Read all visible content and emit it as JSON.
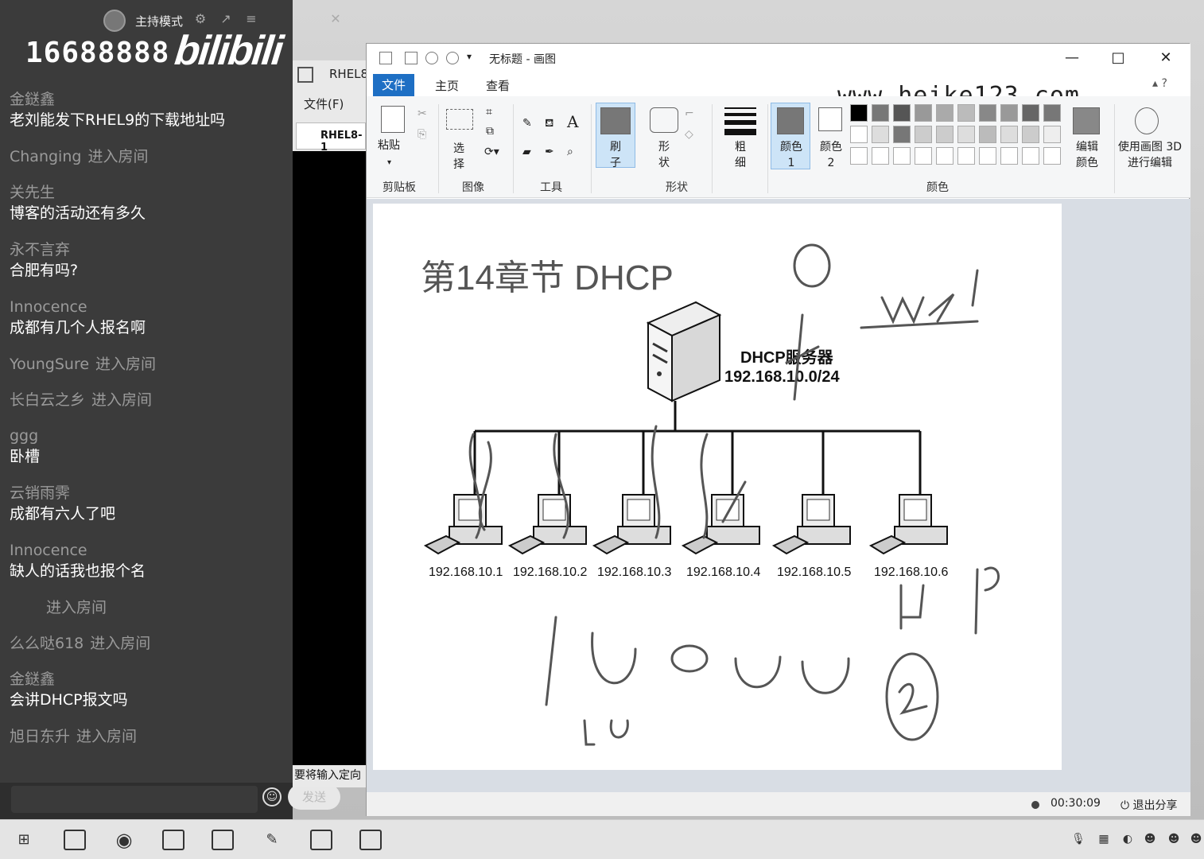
{
  "chat": {
    "host_mode": "主持模式",
    "room_id": "16688888",
    "logo": "bilibili",
    "messages": [
      {
        "user": "金鎹鑫",
        "text": "老刘能发下RHEL9的下载地址吗"
      },
      {
        "user": "Changing",
        "enter": "进入房间"
      },
      {
        "user": "关先生",
        "text": "博客的活动还有多久"
      },
      {
        "user": "永不言弃",
        "text": "合肥有吗?"
      },
      {
        "user": "Innocence",
        "text": "成都有几个人报名啊"
      },
      {
        "user": "YoungSure",
        "enter": "进入房间"
      },
      {
        "user": "长白云之乡",
        "enter": "进入房间"
      },
      {
        "user": "ggg",
        "text": "卧槽"
      },
      {
        "user": "云销雨霁",
        "text": "成都有六人了吧"
      },
      {
        "user": "Innocence",
        "text": "缺人的话我也报个名"
      },
      {
        "user": "",
        "enter": "进入房间"
      },
      {
        "user": "么么哒618",
        "enter": "进入房间"
      },
      {
        "user": "金鎹鑫",
        "text": "会讲DHCP报文吗"
      },
      {
        "user": "旭日东升",
        "enter": "进入房间"
      }
    ],
    "send_label": "发送"
  },
  "vm": {
    "title": "RHEL8",
    "menu_file": "文件(F)",
    "tab_label": "RHEL8-1",
    "status_text": "要将输入定向"
  },
  "paint": {
    "title": "无标题 - 画图",
    "tabs": {
      "file": "文件",
      "home": "主页",
      "view": "查看"
    },
    "watermark": "www.heike123.com",
    "ribbon": {
      "paste": "粘贴",
      "select": "选择",
      "brush": "刷子",
      "shapes": "形状",
      "size": "粗细",
      "color1": "颜色 1",
      "color2": "颜色 2",
      "edit_colors": "编辑颜色",
      "paint3d": "使用画图 3D 进行编辑",
      "groups": {
        "clipboard": "剪贴板",
        "image": "图像",
        "tools": "工具",
        "shapes": "形状",
        "colors": "颜色"
      }
    },
    "status": {
      "time": "00:30:09",
      "exit_share": "退出分享"
    }
  },
  "diagram": {
    "title": "第14章节 DHCP",
    "server_name": "DHCP服务器",
    "server_subnet": "192.168.10.0/24",
    "clients": [
      "192.168.10.1",
      "192.168.10.2",
      "192.168.10.3",
      "192.168.10.4",
      "192.168.10.5",
      "192.168.10.6"
    ]
  },
  "colors": {
    "accent": "#1e6fc4",
    "chat_bg": "#3b3b3b"
  }
}
